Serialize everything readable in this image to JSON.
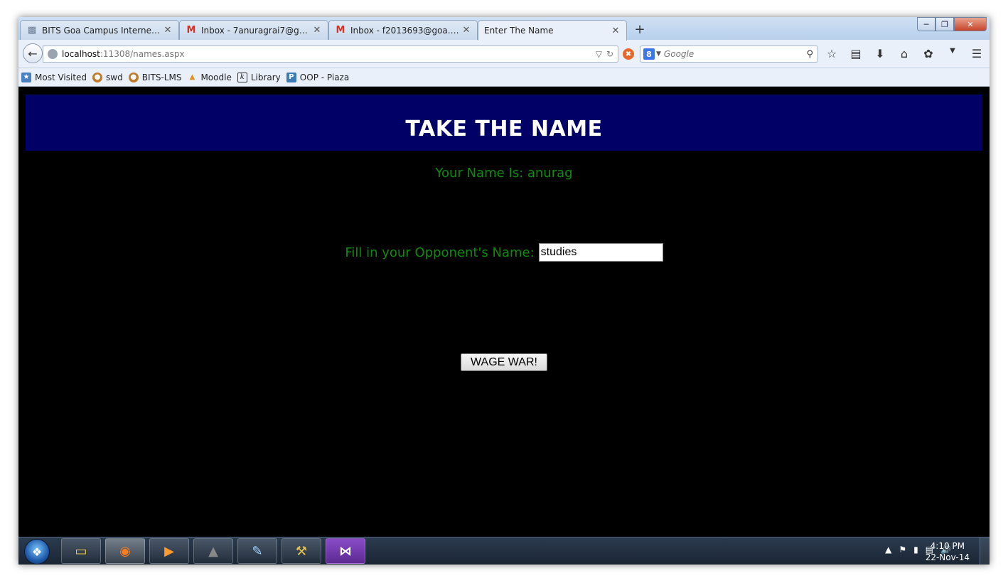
{
  "tabs": [
    {
      "title": "BITS Goa Campus Internet ...",
      "icon": "network-icon",
      "active": false
    },
    {
      "title": "Inbox - 7anuragrai7@gmail...",
      "icon": "gmail-icon",
      "active": false
    },
    {
      "title": "Inbox - f2013693@goa.bits...",
      "icon": "gmail-icon",
      "active": false
    },
    {
      "title": "Enter The Name",
      "icon": "",
      "active": true
    }
  ],
  "url": {
    "host": "localhost",
    "path": ":11308/names.aspx"
  },
  "search": {
    "engine_badge": "8",
    "placeholder": "Google"
  },
  "bookmarks": [
    {
      "label": "Most Visited"
    },
    {
      "label": "swd"
    },
    {
      "label": "BITS-LMS"
    },
    {
      "label": "Moodle"
    },
    {
      "label": "Library"
    },
    {
      "label": "OOP - Piaza"
    }
  ],
  "page": {
    "banner_title": "TAKE THE NAME",
    "your_name_text": "Your Name Is: anurag",
    "opponent_label": "Fill in your Opponent's Name:",
    "opponent_value": "studies",
    "button_label": "WAGE WAR!",
    "banner_color": "#000066",
    "text_color": "#0e8a0e"
  },
  "clock": {
    "time": "4:10 PM",
    "date": "22-Nov-14"
  }
}
